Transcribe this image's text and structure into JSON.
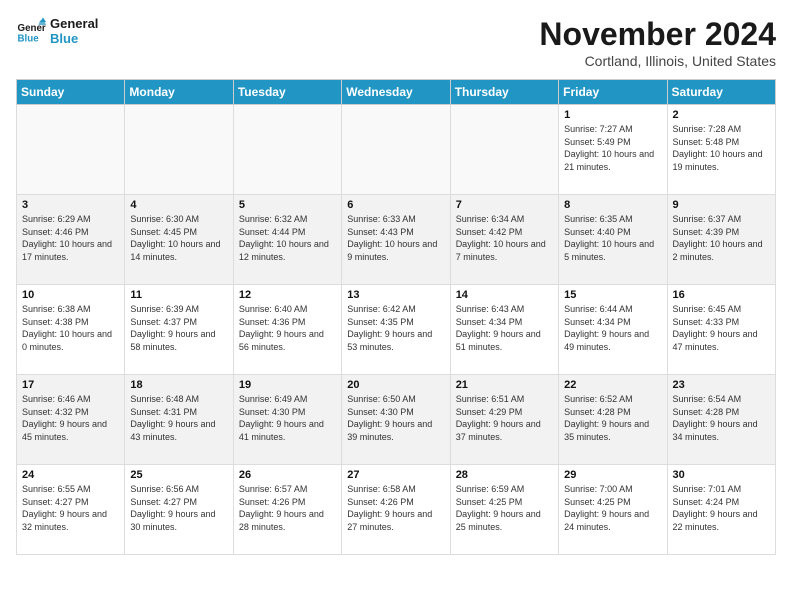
{
  "logo": {
    "line1": "General",
    "line2": "Blue"
  },
  "title": "November 2024",
  "location": "Cortland, Illinois, United States",
  "days_of_week": [
    "Sunday",
    "Monday",
    "Tuesday",
    "Wednesday",
    "Thursday",
    "Friday",
    "Saturday"
  ],
  "weeks": [
    [
      {
        "day": "",
        "info": ""
      },
      {
        "day": "",
        "info": ""
      },
      {
        "day": "",
        "info": ""
      },
      {
        "day": "",
        "info": ""
      },
      {
        "day": "",
        "info": ""
      },
      {
        "day": "1",
        "info": "Sunrise: 7:27 AM\nSunset: 5:49 PM\nDaylight: 10 hours and 21 minutes."
      },
      {
        "day": "2",
        "info": "Sunrise: 7:28 AM\nSunset: 5:48 PM\nDaylight: 10 hours and 19 minutes."
      }
    ],
    [
      {
        "day": "3",
        "info": "Sunrise: 6:29 AM\nSunset: 4:46 PM\nDaylight: 10 hours and 17 minutes."
      },
      {
        "day": "4",
        "info": "Sunrise: 6:30 AM\nSunset: 4:45 PM\nDaylight: 10 hours and 14 minutes."
      },
      {
        "day": "5",
        "info": "Sunrise: 6:32 AM\nSunset: 4:44 PM\nDaylight: 10 hours and 12 minutes."
      },
      {
        "day": "6",
        "info": "Sunrise: 6:33 AM\nSunset: 4:43 PM\nDaylight: 10 hours and 9 minutes."
      },
      {
        "day": "7",
        "info": "Sunrise: 6:34 AM\nSunset: 4:42 PM\nDaylight: 10 hours and 7 minutes."
      },
      {
        "day": "8",
        "info": "Sunrise: 6:35 AM\nSunset: 4:40 PM\nDaylight: 10 hours and 5 minutes."
      },
      {
        "day": "9",
        "info": "Sunrise: 6:37 AM\nSunset: 4:39 PM\nDaylight: 10 hours and 2 minutes."
      }
    ],
    [
      {
        "day": "10",
        "info": "Sunrise: 6:38 AM\nSunset: 4:38 PM\nDaylight: 10 hours and 0 minutes."
      },
      {
        "day": "11",
        "info": "Sunrise: 6:39 AM\nSunset: 4:37 PM\nDaylight: 9 hours and 58 minutes."
      },
      {
        "day": "12",
        "info": "Sunrise: 6:40 AM\nSunset: 4:36 PM\nDaylight: 9 hours and 56 minutes."
      },
      {
        "day": "13",
        "info": "Sunrise: 6:42 AM\nSunset: 4:35 PM\nDaylight: 9 hours and 53 minutes."
      },
      {
        "day": "14",
        "info": "Sunrise: 6:43 AM\nSunset: 4:34 PM\nDaylight: 9 hours and 51 minutes."
      },
      {
        "day": "15",
        "info": "Sunrise: 6:44 AM\nSunset: 4:34 PM\nDaylight: 9 hours and 49 minutes."
      },
      {
        "day": "16",
        "info": "Sunrise: 6:45 AM\nSunset: 4:33 PM\nDaylight: 9 hours and 47 minutes."
      }
    ],
    [
      {
        "day": "17",
        "info": "Sunrise: 6:46 AM\nSunset: 4:32 PM\nDaylight: 9 hours and 45 minutes."
      },
      {
        "day": "18",
        "info": "Sunrise: 6:48 AM\nSunset: 4:31 PM\nDaylight: 9 hours and 43 minutes."
      },
      {
        "day": "19",
        "info": "Sunrise: 6:49 AM\nSunset: 4:30 PM\nDaylight: 9 hours and 41 minutes."
      },
      {
        "day": "20",
        "info": "Sunrise: 6:50 AM\nSunset: 4:30 PM\nDaylight: 9 hours and 39 minutes."
      },
      {
        "day": "21",
        "info": "Sunrise: 6:51 AM\nSunset: 4:29 PM\nDaylight: 9 hours and 37 minutes."
      },
      {
        "day": "22",
        "info": "Sunrise: 6:52 AM\nSunset: 4:28 PM\nDaylight: 9 hours and 35 minutes."
      },
      {
        "day": "23",
        "info": "Sunrise: 6:54 AM\nSunset: 4:28 PM\nDaylight: 9 hours and 34 minutes."
      }
    ],
    [
      {
        "day": "24",
        "info": "Sunrise: 6:55 AM\nSunset: 4:27 PM\nDaylight: 9 hours and 32 minutes."
      },
      {
        "day": "25",
        "info": "Sunrise: 6:56 AM\nSunset: 4:27 PM\nDaylight: 9 hours and 30 minutes."
      },
      {
        "day": "26",
        "info": "Sunrise: 6:57 AM\nSunset: 4:26 PM\nDaylight: 9 hours and 28 minutes."
      },
      {
        "day": "27",
        "info": "Sunrise: 6:58 AM\nSunset: 4:26 PM\nDaylight: 9 hours and 27 minutes."
      },
      {
        "day": "28",
        "info": "Sunrise: 6:59 AM\nSunset: 4:25 PM\nDaylight: 9 hours and 25 minutes."
      },
      {
        "day": "29",
        "info": "Sunrise: 7:00 AM\nSunset: 4:25 PM\nDaylight: 9 hours and 24 minutes."
      },
      {
        "day": "30",
        "info": "Sunrise: 7:01 AM\nSunset: 4:24 PM\nDaylight: 9 hours and 22 minutes."
      }
    ]
  ]
}
